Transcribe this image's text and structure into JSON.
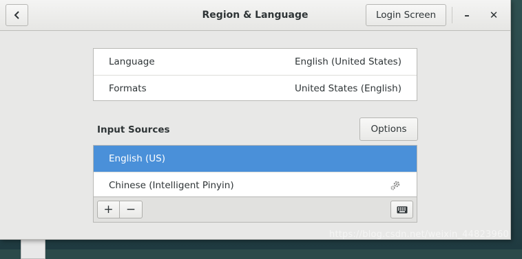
{
  "window": {
    "title": "Region & Language",
    "login_screen_label": "Login Screen",
    "minimize_glyph": "–",
    "close_glyph": "✕"
  },
  "language_panel": {
    "rows": [
      {
        "label": "Language",
        "value": "English (United States)"
      },
      {
        "label": "Formats",
        "value": "United States (English)"
      }
    ]
  },
  "input_sources": {
    "title": "Input Sources",
    "options_label": "Options",
    "items": [
      {
        "label": "English (US)",
        "selected": true
      },
      {
        "label": "Chinese (Intelligent Pinyin)",
        "selected": false,
        "icon": "gear-icon"
      }
    ],
    "toolbar": {
      "add_glyph": "+",
      "remove_glyph": "−",
      "keyboard_icon": "keyboard-icon"
    }
  },
  "watermark": "https://blog.csdn.net/weixin_44823960",
  "colors": {
    "selection": "#4a90d9",
    "window_bg": "#e8e8e7"
  }
}
